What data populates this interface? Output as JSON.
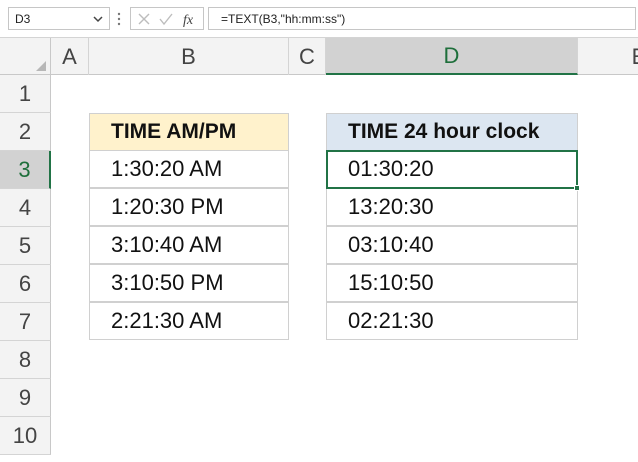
{
  "formula_bar": {
    "name_box": "D3",
    "formula": "=TEXT(B3,\"hh:mm:ss\")",
    "icons": [
      "chevron-down-icon",
      "more-dots-icon",
      "cancel-icon",
      "enter-check-icon",
      "insert-function-icon"
    ]
  },
  "columns": [
    "A",
    "B",
    "C",
    "D",
    "E"
  ],
  "selected_column": "D",
  "rows": [
    "1",
    "2",
    "3",
    "4",
    "5",
    "6",
    "7",
    "8",
    "9",
    "10"
  ],
  "selected_row": "3",
  "table_b": {
    "header": "TIME AM/PM",
    "values": [
      "1:30:20 AM",
      "1:20:30 PM",
      "3:10:40 AM",
      "3:10:50 PM",
      "2:21:30 AM"
    ]
  },
  "table_d": {
    "header": "TIME 24 hour clock",
    "values": [
      "01:30:20",
      "13:20:30",
      "03:10:40",
      "15:10:50",
      "02:21:30"
    ]
  },
  "colors": {
    "accent": "#217346",
    "header_b_fill": "#fff2cc",
    "header_d_fill": "#dce6f1"
  }
}
